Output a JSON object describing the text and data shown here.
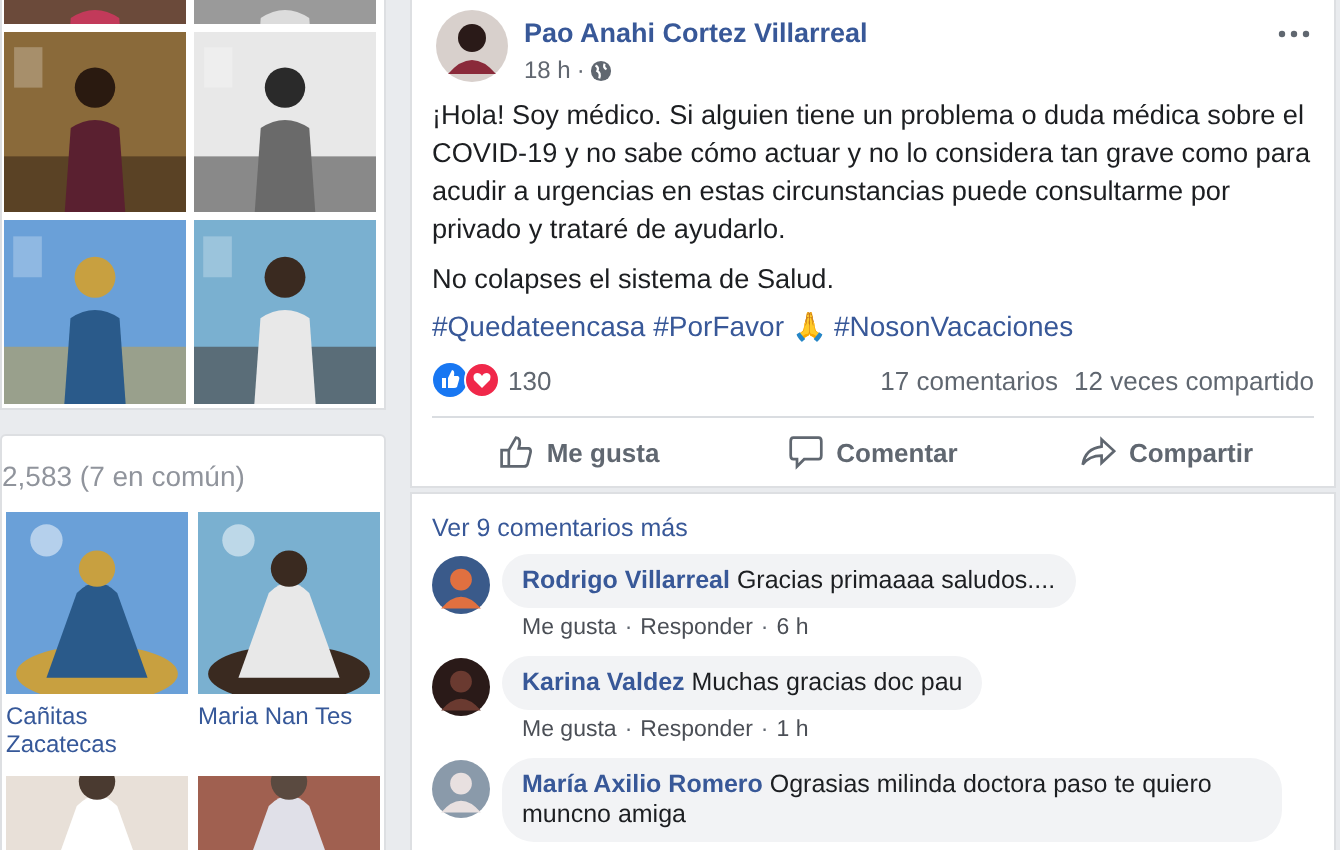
{
  "photos": [
    {
      "kind": "picture"
    },
    {
      "kind": "picture"
    },
    {
      "kind": "picture"
    },
    {
      "kind": "picture"
    },
    {
      "kind": "picture"
    },
    {
      "kind": "picture"
    }
  ],
  "friends": {
    "count": "2,583 (7 en común)",
    "items": [
      {
        "name": "Cañitas Zacatecas"
      },
      {
        "name": "Maria Nan Tes"
      },
      {
        "kind": "picture"
      },
      {
        "kind": "picture"
      }
    ]
  },
  "post": {
    "author": "Pao Anahi Cortez Villarreal",
    "time": "18 h",
    "separator": "·",
    "paragraphs": [
      "¡Hola! Soy médico. Si alguien tiene un problema o duda médica sobre el COVID-19 y no sabe cómo actuar y no lo considera tan grave como para acudir a urgencias en estas circunstancias puede consultarme por privado y trataré de ayudarlo.",
      "No colapses el sistema de Salud."
    ],
    "hashtags": [
      "#Quedateencasa",
      "#PorFavor",
      "🙏",
      "#NosonVacaciones"
    ],
    "reaction_count": "130",
    "comments_count": "17 comentarios",
    "shares_count": "12 veces compartido",
    "actions": [
      {
        "kind": "like",
        "label": "Me gusta"
      },
      {
        "kind": "comment",
        "label": "Comentar"
      },
      {
        "kind": "share",
        "label": "Compartir"
      }
    ]
  },
  "more_comments": "Ver 9 comentarios más",
  "comments": [
    {
      "author": "Rodrigo Villarreal",
      "text": "Gracias primaaaa saludos....",
      "like": "Me gusta",
      "reply": "Responder",
      "time": "6 h",
      "separators": [
        "·",
        "·"
      ]
    },
    {
      "author": "Karina Valdez",
      "text": "Muchas gracias doc pau",
      "like": "Me gusta",
      "reply": "Responder",
      "time": "1 h",
      "separators": [
        "·",
        "·"
      ]
    },
    {
      "author": "María Axilio Romero",
      "text": "Ograsias milinda doctora paso te quiero muncno amiga"
    }
  ]
}
